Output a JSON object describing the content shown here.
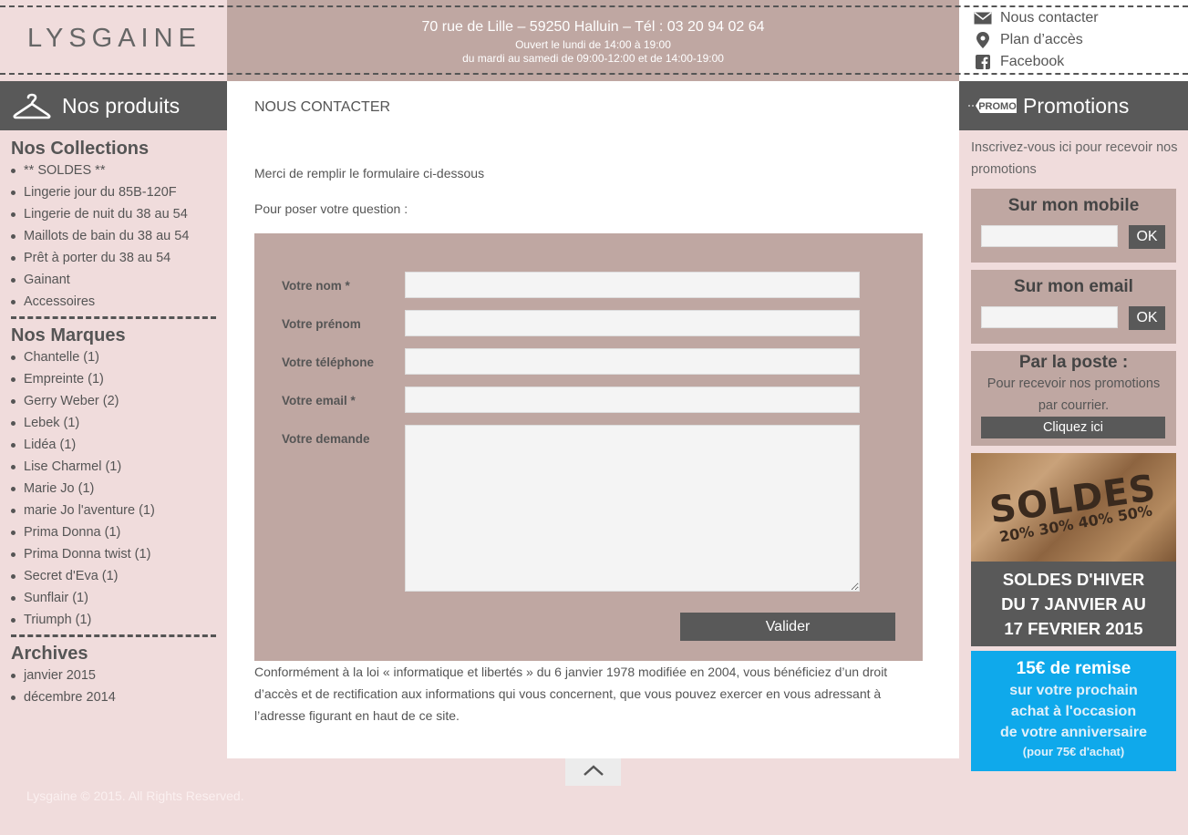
{
  "header": {
    "logo": "LYSGAINE",
    "address": "70 rue de Lille – 59250 Halluin – Tél : 03 20 94 02 64",
    "hours_line1": "Ouvert le lundi de 14:00 à 19:00",
    "hours_line2": "du mardi au samedi de 09:00-12:00 et de 14:00-19:00",
    "links": [
      {
        "label": "Nous contacter",
        "icon": "envelope-icon"
      },
      {
        "label": "Plan d’accès",
        "icon": "map-pin-icon"
      },
      {
        "label": "Facebook",
        "icon": "facebook-icon"
      }
    ]
  },
  "sidebar": {
    "title": "Nos produits",
    "icon": "hanger-icon",
    "collections_title": "Nos Collections",
    "collections": [
      "** SOLDES **",
      "Lingerie jour du 85B-120F",
      "Lingerie de nuit du 38 au 54",
      "Maillots de bain du 38 au 54",
      "Prêt à porter du 38 au 54",
      "Gainant",
      "Accessoires"
    ],
    "brands_title": "Nos Marques",
    "brands": [
      "Chantelle (1)",
      "Empreinte (1)",
      "Gerry Weber (2)",
      "Lebek (1)",
      "Lidéa (1)",
      "Lise Charmel (1)",
      "Marie Jo (1)",
      "marie Jo l'aventure (1)",
      "Prima Donna (1)",
      "Prima Donna twist (1)",
      "Secret d'Eva (1)",
      "Sunflair (1)",
      "Triumph (1)"
    ],
    "archives_title": "Archives",
    "archives": [
      "janvier 2015",
      "décembre 2014"
    ]
  },
  "main": {
    "title": "NOUS CONTACTER",
    "intro": "Merci de remplir le formulaire ci-dessous",
    "question_label": "Pour poser votre question :",
    "form": {
      "nom": "Votre nom *",
      "prenom": "Votre prénom",
      "telephone": "Votre téléphone",
      "email": "Votre email *",
      "demande": "Votre demande",
      "submit": "Valider"
    },
    "legal": "Conformément à la loi « informatique et libertés » du 6 janvier 1978 modifiée en 2004, vous bénéficiez d’un droit d’accès et de rectification aux informations qui vous concernent, que vous pouvez exercer en vous adressant à l’adresse figurant en haut de ce site."
  },
  "promotions": {
    "title": "Promotions",
    "icon_text": "PROMO",
    "intro": "Inscrivez-vous ici pour recevoir nos promotions",
    "mobile_title": "Sur mon mobile",
    "email_title": "Sur mon email",
    "ok_label": "OK",
    "poste_title": "Par la poste :",
    "poste_text": "Pour recevoir nos promotions par courrier.",
    "poste_button": "Cliquez ici",
    "soldes_image_word": "SOLDES",
    "soldes_image_pct": "20% 30% 40% 50%",
    "soldes_banner_1": "SOLDES D'HIVER",
    "soldes_banner_2": "DU 7 JANVIER AU",
    "soldes_banner_3": "17 FEVRIER 2015",
    "anniv_1": "15€ de remise",
    "anniv_2": "sur votre prochain",
    "anniv_3": "achat à l'occasion",
    "anniv_4": "de votre anniversaire",
    "anniv_5": "(pour 75€ d'achat)"
  },
  "footer": {
    "copyright": "Lysgaine © 2015. All Rights Reserved."
  },
  "colors": {
    "background": "#f0dcdc",
    "taupe": "#bfa7a2",
    "dark": "#595959",
    "blue": "#0fa9eb"
  }
}
